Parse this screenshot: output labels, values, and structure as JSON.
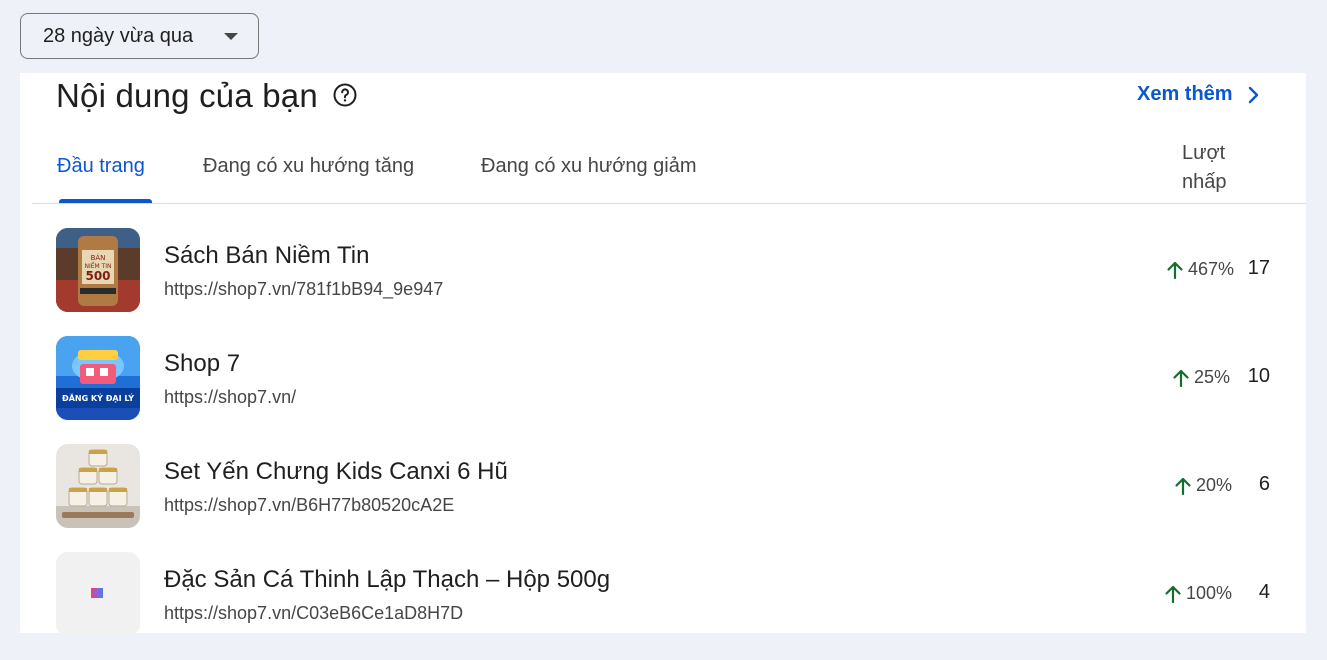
{
  "date_range": {
    "label": "28 ngày vừa qua"
  },
  "card": {
    "title": "Nội dung của bạn",
    "see_more": "Xem thêm",
    "column_header": "Lượt nhấp"
  },
  "tabs": [
    {
      "label": "Đầu trang",
      "active": true
    },
    {
      "label": "Đang có xu hướng tăng",
      "active": false
    },
    {
      "label": "Đang có xu hướng giảm",
      "active": false
    }
  ],
  "rows": [
    {
      "title": "Sách Bán Niềm Tin",
      "url": "https://shop7.vn/781f1bB94_9e947",
      "change": "467%",
      "clicks": "17",
      "thumb_text": "BÁN NIỀM TIN 500"
    },
    {
      "title": "Shop 7",
      "url": "https://shop7.vn/",
      "change": "25%",
      "clicks": "10",
      "thumb_text": "ĐĂNG KÝ ĐẠI LÝ"
    },
    {
      "title": "Set Yến Chưng Kids Canxi 6 Hũ",
      "url": "https://shop7.vn/B6H77b80520cA2E",
      "change": "20%",
      "clicks": "6",
      "thumb_text": ""
    },
    {
      "title": "Đặc Sản Cá Thinh Lập Thạch – Hộp 500g",
      "url": "https://shop7.vn/C03eB6Ce1aD8H7D",
      "change": "100%",
      "clicks": "4",
      "thumb_text": ""
    }
  ],
  "colors": {
    "accent": "#0b57d0",
    "trend_up": "#146c2e",
    "background": "#eef2f8"
  }
}
